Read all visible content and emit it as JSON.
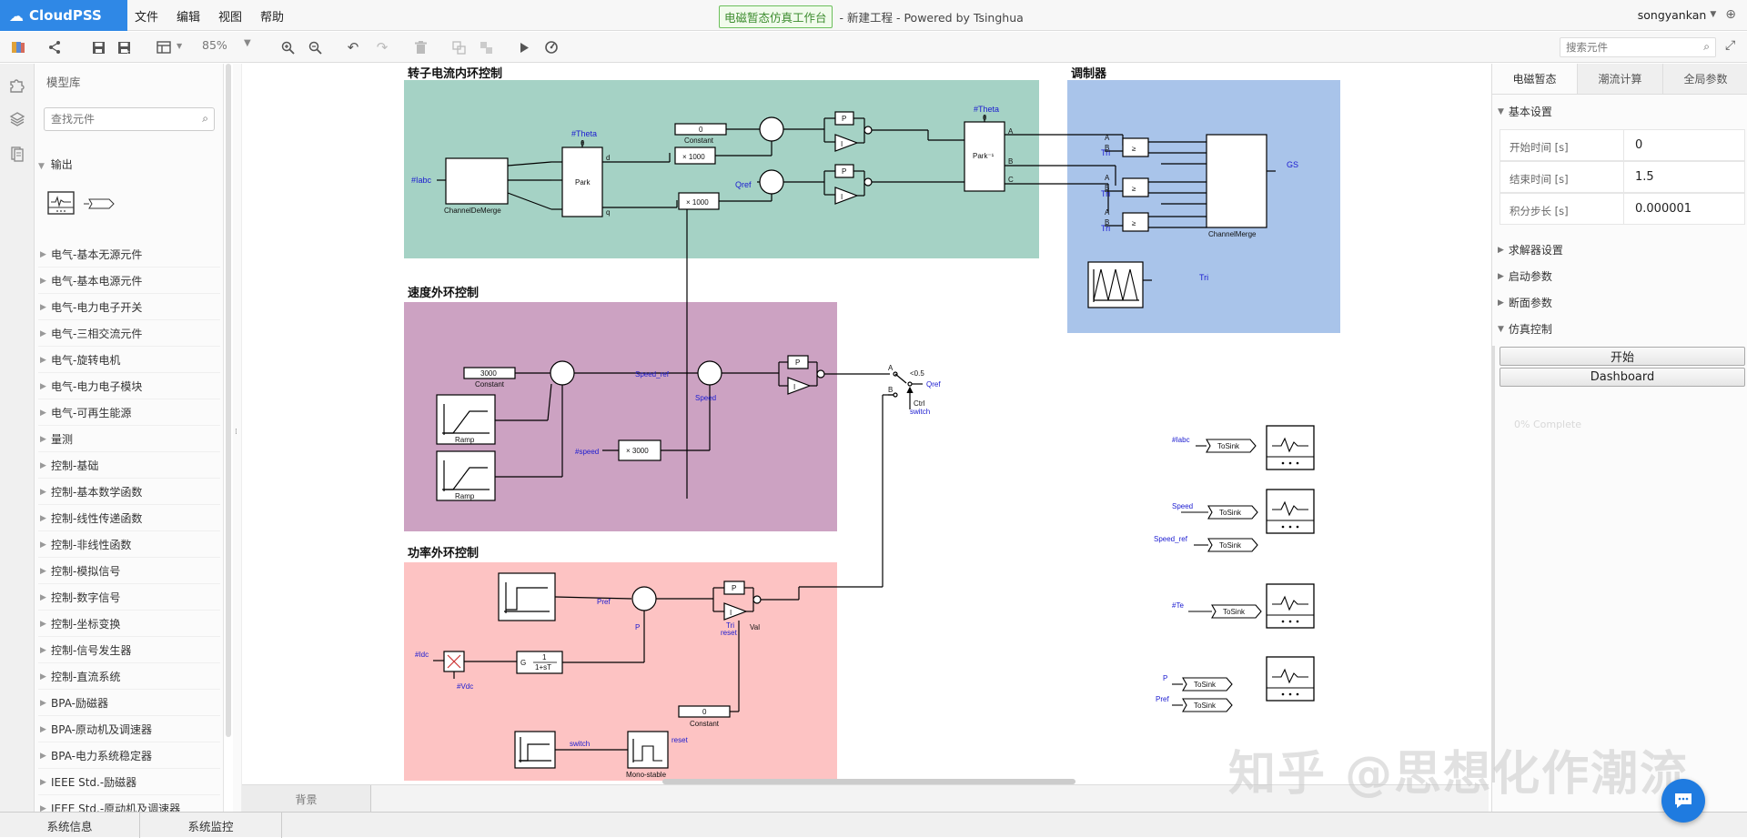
{
  "header": {
    "logo": "CloudPSS",
    "menu": [
      "文件",
      "编辑",
      "视图",
      "帮助"
    ],
    "workspace_badge": "电磁暂态仿真工作台",
    "project_title": "- 新建工程 - Powered by Tsinghua",
    "user": "songyankan"
  },
  "toolbar": {
    "zoom": "85%",
    "search_placeholder": "搜索元件"
  },
  "library": {
    "title": "模型库",
    "search_placeholder": "查找元件",
    "output_category": "输出",
    "categories": [
      "电气-基本无源元件",
      "电气-基本电源元件",
      "电气-电力电子开关",
      "电气-三相交流元件",
      "电气-旋转电机",
      "电气-电力电子模块",
      "电气-可再生能源",
      "量测",
      "控制-基础",
      "控制-基本数学函数",
      "控制-线性传递函数",
      "控制-非线性函数",
      "控制-模拟信号",
      "控制-数字信号",
      "控制-坐标变换",
      "控制-信号发生器",
      "控制-直流系统",
      "BPA-励磁器",
      "BPA-原动机及调速器",
      "BPA-电力系统稳定器",
      "IEEE Std.-励磁器",
      "IEEE Std.-原动机及调速器"
    ]
  },
  "canvas": {
    "groups": {
      "rotor": "转子电流内环控制",
      "modulator": "调制器",
      "speed": "速度外环控制",
      "power": "功率外环控制"
    },
    "labels": {
      "labc": "#Iabc",
      "channel_demerge": "ChannelDeMerge",
      "theta": "#Theta",
      "theta_sym": "θ",
      "park": "Park",
      "park_inv": "Park⁻¹",
      "d": "d",
      "q": "q",
      "A": "A",
      "B": "B",
      "C": "C",
      "constant": "Constant",
      "zero": "0",
      "x1000": "× 1000",
      "qref": "Qref",
      "P": "P",
      "I": "I",
      "tri": "Tri",
      "ge": "≥",
      "channel_merge": "ChannelMerge",
      "gs": "GS",
      "c3000": "3000",
      "speed_ref": "Speed_ref",
      "speed": "Speed",
      "speed_tag": "#speed",
      "x3000": "× 3000",
      "ramp": "Ramp",
      "lt05": "<0.5",
      "ctrl": "Ctrl",
      "switch": "switch",
      "pref": "Pref",
      "idc": "#Idc",
      "vdc": "#Vdc",
      "gtf_g": "G",
      "gtf_num": "1",
      "gtf_den": "1+sT",
      "reset": "reset",
      "val": "Val",
      "mono": "Mono-stable",
      "tosink": "ToSink",
      "sink_labc": "#Iabc",
      "sink_speed": "Speed",
      "sink_speedref": "Speed_ref",
      "sink_te": "#Te",
      "sink_p": "P",
      "sink_pref": "Pref"
    },
    "bottom_tab": "背景"
  },
  "right": {
    "tabs": [
      "电磁暂态",
      "潮流计算",
      "全局参数"
    ],
    "basic_section": "基本设置",
    "props": [
      {
        "k": "开始时间 [s]",
        "v": "0"
      },
      {
        "k": "结束时间 [s]",
        "v": "1.5"
      },
      {
        "k": "积分步长 [s]",
        "v": "0.000001"
      }
    ],
    "sections": [
      "求解器设置",
      "启动参数",
      "断面参数",
      "仿真控制"
    ],
    "start_button": "开始",
    "dashboard_button": "Dashboard",
    "progress_text": "0% Complete"
  },
  "status": {
    "tabs": [
      "系统信息",
      "系统监控"
    ]
  },
  "watermark": "知乎 @思想化作潮流"
}
